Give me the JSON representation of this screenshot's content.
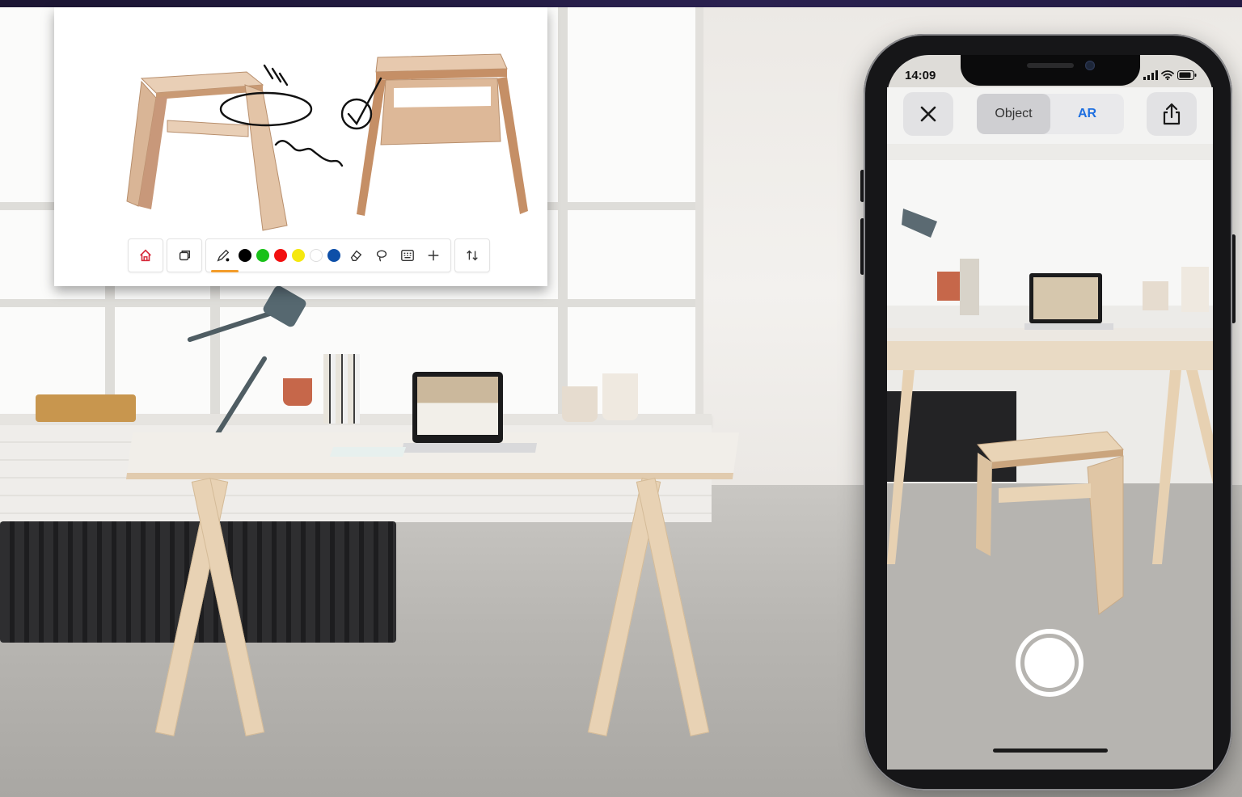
{
  "annotation_card": {
    "handwritten_note": "replace",
    "toolbar": {
      "home_icon": "home-icon",
      "pages_icon": "pages-icon",
      "pen_icon": "pen-icon",
      "colors": [
        "#000000",
        "#19c119",
        "#f20f0f",
        "#f5e80e",
        "#ffffff",
        "#0d4fa8"
      ],
      "eraser_icon": "eraser-icon",
      "lasso_icon": "lasso-icon",
      "keyboard_icon": "keyboard-icon",
      "add_icon": "plus-icon",
      "swap_icon": "swap-vertical-icon",
      "accent": "#f39c2a"
    }
  },
  "phone": {
    "status": {
      "time": "14:09",
      "signal_icon": "signal-icon",
      "wifi_icon": "wifi-icon",
      "battery_icon": "battery-icon"
    },
    "viewer": {
      "close_icon": "close-icon",
      "segments": [
        {
          "label": "Object",
          "active": true
        },
        {
          "label": "AR",
          "active": false
        }
      ],
      "share_icon": "share-icon",
      "accent": "#1e6fe0"
    },
    "shutter_icon": "shutter-button"
  }
}
